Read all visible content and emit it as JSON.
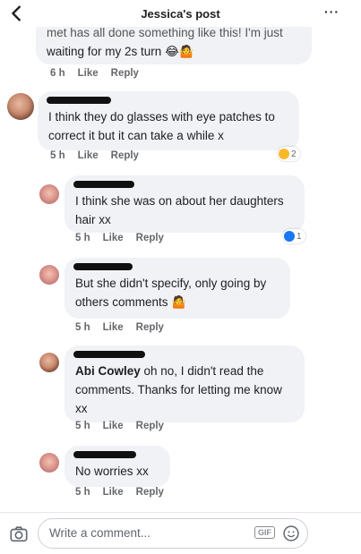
{
  "header": {
    "title": "Jessica's post",
    "more": "···"
  },
  "comments": [
    {
      "partial_text": "met has all done something like this! I'm just",
      "text": "waiting for my 2s turn",
      "emojis": "😂🤷",
      "time": "6 h",
      "like": "Like",
      "reply": "Reply"
    },
    {
      "text_line1": "I think they do glasses with eye patches to",
      "text_line2": "correct it but it can take a while x",
      "time": "5 h",
      "like": "Like",
      "reply": "Reply",
      "reaction_count": "2"
    },
    {
      "text_line1": "I think she was on about her daughters",
      "text_line2": "hair xx",
      "time": "5 h",
      "like": "Like",
      "reply": "Reply",
      "reaction_count": "1"
    },
    {
      "text_line1": "But she didn't specify, only going by",
      "text_line2": "others comments",
      "emojis": "🤷",
      "time": "5 h",
      "like": "Like",
      "reply": "Reply"
    },
    {
      "mention": "Abi Cowley",
      "text_line1": " oh no, I didn't read the",
      "text_line2": "comments. Thanks for letting me know",
      "text_line3": "xx",
      "time": "5 h",
      "like": "Like",
      "reply": "Reply"
    },
    {
      "text": "No worries xx",
      "time": "5 h",
      "like": "Like",
      "reply": "Reply"
    }
  ],
  "composer": {
    "placeholder": "Write a comment...",
    "gif_label": "GIF"
  },
  "colors": {
    "bubble": "#f0f2f5",
    "like_reaction": "#1877f2",
    "haha_reaction": "#f7b928",
    "meta": "#65676b"
  }
}
